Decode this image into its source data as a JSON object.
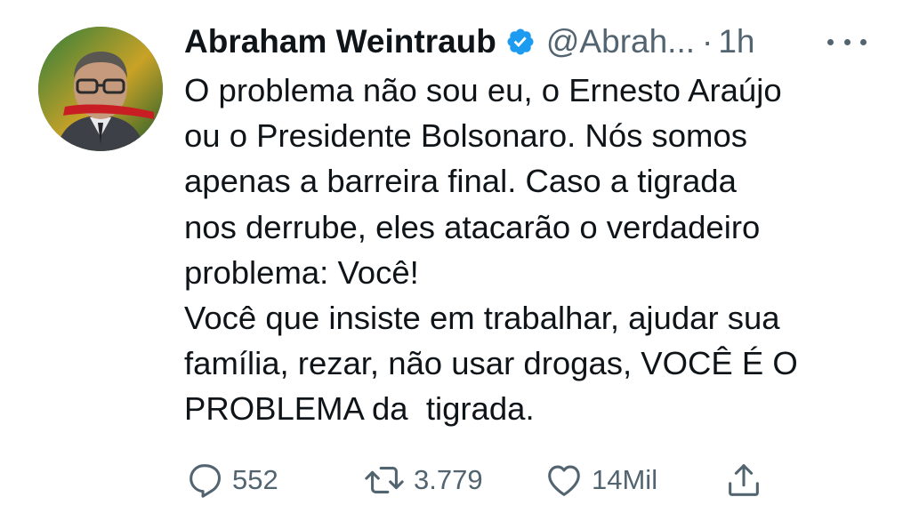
{
  "tweet": {
    "author": {
      "display_name": "Abraham Weintraub",
      "handle": "@Abrah...",
      "verified": true,
      "avatar_icon": "profile-photo"
    },
    "separator": "·",
    "time": "1h",
    "more_icon": "more-horizontal-icon",
    "text_lines": [
      "O problema não sou eu, o Ernesto Araújo",
      "ou o Presidente Bolsonaro. Nós somos",
      "apenas a barreira final. Caso a tigrada",
      "nos derrube, eles atacarão o verdadeiro",
      "problema: Você!",
      "Você que insiste em trabalhar, ajudar sua",
      "família, rezar, não usar drogas, VOCÊ É O",
      "PROBLEMA da  tigrada."
    ],
    "actions": {
      "reply": {
        "count": "552",
        "icon": "reply-icon"
      },
      "retweet": {
        "count": "3.779",
        "icon": "retweet-icon"
      },
      "like": {
        "count": "14Mil",
        "icon": "heart-icon"
      },
      "share": {
        "icon": "share-icon"
      }
    },
    "colors": {
      "text": "#0f1419",
      "secondary": "#536471",
      "verified": "#1d9bf0"
    }
  }
}
